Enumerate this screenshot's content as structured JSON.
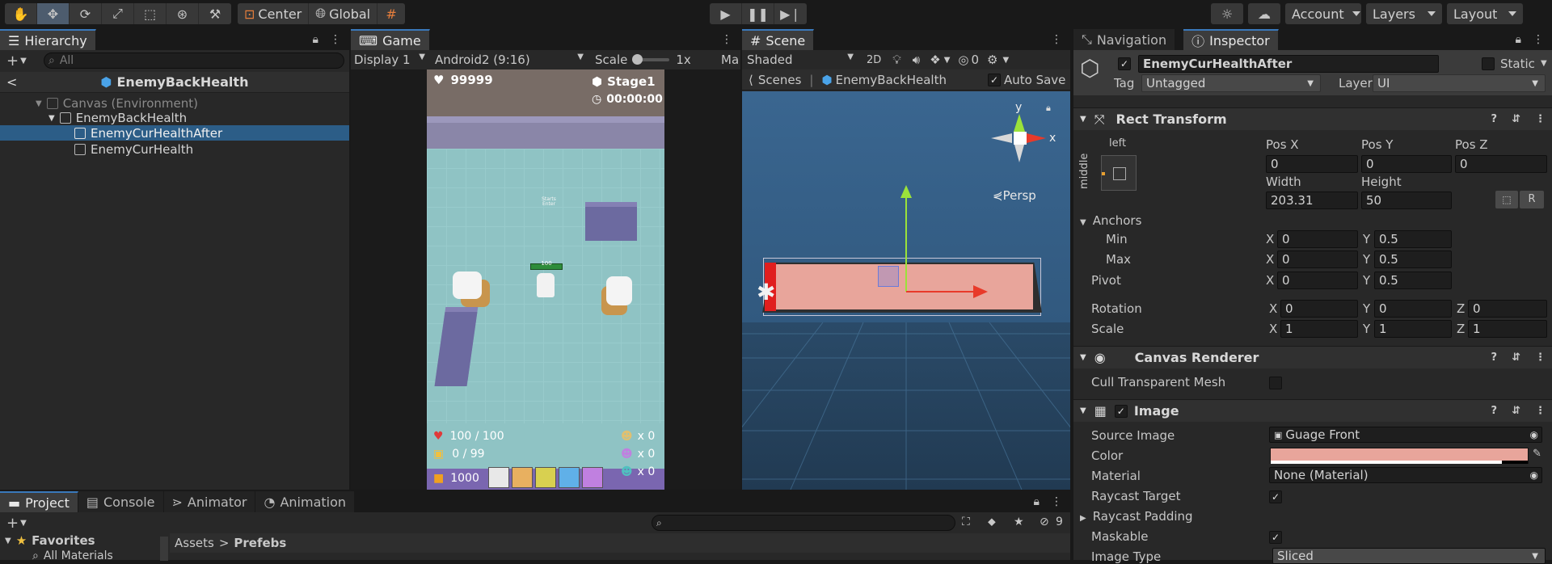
{
  "toolbar": {
    "pivot_mode": "Center",
    "pivot_rotation": "Global",
    "account": "Account",
    "layers": "Layers",
    "layout": "Layout"
  },
  "hierarchy": {
    "tab": "Hierarchy",
    "search_placeholder": "All",
    "scene_title": "EnemyBackHealth",
    "items": [
      {
        "label": "Canvas (Environment)"
      },
      {
        "label": "EnemyBackHealth"
      },
      {
        "label": "EnemyCurHealthAfter"
      },
      {
        "label": "EnemyCurHealth"
      }
    ]
  },
  "game": {
    "tab": "Game",
    "display": "Display 1",
    "resolution": "Android2 (9:16)",
    "scale_label": "Scale",
    "scale_value": "1x",
    "ma": "Ma",
    "hud": {
      "coins": "99999",
      "stage": "Stage1",
      "timer": "00:00:00",
      "hp": "100 / 100",
      "bag": "0 / 99",
      "gold": "1000",
      "enemy_hp": "100",
      "counts": [
        "x 0",
        "x 0",
        "x 0"
      ]
    }
  },
  "scene": {
    "tab": "Scene",
    "shading": "Shaded",
    "mode_2d": "2D",
    "hidden_count": "0",
    "breadcrumb_root": "Scenes",
    "breadcrumb_item": "EnemyBackHealth",
    "auto_save": "Auto Save",
    "persp": "Persp",
    "gizmo_y": "y",
    "gizmo_x": "x"
  },
  "inspector": {
    "tab_nav": "Navigation",
    "tab_inspector": "Inspector",
    "object_name": "EnemyCurHealthAfter",
    "static_label": "Static",
    "tag_label": "Tag",
    "tag_value": "Untagged",
    "layer_label": "Layer",
    "layer_value": "UI",
    "rect": {
      "title": "Rect Transform",
      "anchor_h": "left",
      "anchor_v": "middle",
      "posx_label": "Pos X",
      "posx": "0",
      "posy_label": "Pos Y",
      "posy": "0",
      "posz_label": "Pos Z",
      "posz": "0",
      "width_label": "Width",
      "width": "203.31",
      "height_label": "Height",
      "height": "50",
      "anchors_label": "Anchors",
      "min_label": "Min",
      "min_x": "0",
      "min_y": "0.5",
      "max_label": "Max",
      "max_x": "0",
      "max_y": "0.5",
      "pivot_label": "Pivot",
      "pivot_x": "0",
      "pivot_y": "0.5",
      "rotation_label": "Rotation",
      "rot_x": "0",
      "rot_y": "0",
      "rot_z": "0",
      "scale_label": "Scale",
      "scale_x": "1",
      "scale_y": "1",
      "scale_z": "1",
      "x": "X",
      "y": "Y",
      "z": "Z",
      "r_btn": "R"
    },
    "canvas_renderer": {
      "title": "Canvas Renderer",
      "cull_label": "Cull Transparent Mesh"
    },
    "image": {
      "title": "Image",
      "source_label": "Source Image",
      "source_value": "Guage Front",
      "color_label": "Color",
      "color_value": "#e8a59b",
      "material_label": "Material",
      "material_value": "None (Material)",
      "raycast_label": "Raycast Target",
      "padding_label": "Raycast Padding",
      "maskable_label": "Maskable",
      "image_type_label": "Image Type",
      "image_type_value": "Sliced"
    }
  },
  "project": {
    "tabs": [
      "Project",
      "Console",
      "Animator",
      "Animation"
    ],
    "favorites": "Favorites",
    "all_materials": "All Materials",
    "path_root": "Assets",
    "path_item": "Prefebs",
    "hidden_count": "9"
  }
}
